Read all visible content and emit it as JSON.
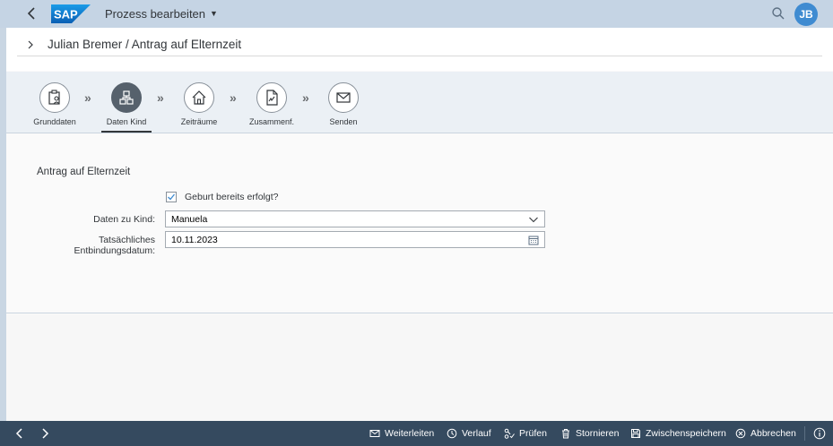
{
  "shell": {
    "logo_text": "SAP",
    "title": "Prozess bearbeiten",
    "avatar_initials": "JB",
    "brand_color": "#0a6ed1"
  },
  "header": {
    "title": "Julian Bremer / Antrag auf Elternzeit"
  },
  "wizard": {
    "steps": [
      {
        "label": "Grunddaten",
        "icon": "clipboard-user-icon",
        "active": false
      },
      {
        "label": "Daten Kind",
        "icon": "org-chart-icon",
        "active": true
      },
      {
        "label": "Zeiträume",
        "icon": "home-icon",
        "active": false
      },
      {
        "label": "Zusammenf.",
        "icon": "document-sign-icon",
        "active": false
      },
      {
        "label": "Senden",
        "icon": "envelope-icon",
        "active": false
      }
    ]
  },
  "form": {
    "title": "Antrag auf Elternzeit",
    "birth_checkbox_label": "Geburt bereits erfolgt?",
    "birth_checked": true,
    "child_label": "Daten zu Kind:",
    "child_value": "Manuela",
    "date_label_line1": "Tatsächliches",
    "date_label_line2": "Entbindungsdatum:",
    "date_value": "10.11.2023"
  },
  "footer": {
    "buttons": [
      {
        "label": "Weiterleiten",
        "icon": "envelope-icon"
      },
      {
        "label": "Verlauf",
        "icon": "history-icon"
      },
      {
        "label": "Prüfen",
        "icon": "check-flow-icon"
      },
      {
        "label": "Stornieren",
        "icon": "trash-icon"
      },
      {
        "label": "Zwischenspeichern",
        "icon": "save-icon"
      },
      {
        "label": "Abbrechen",
        "icon": "cancel-icon"
      }
    ]
  }
}
